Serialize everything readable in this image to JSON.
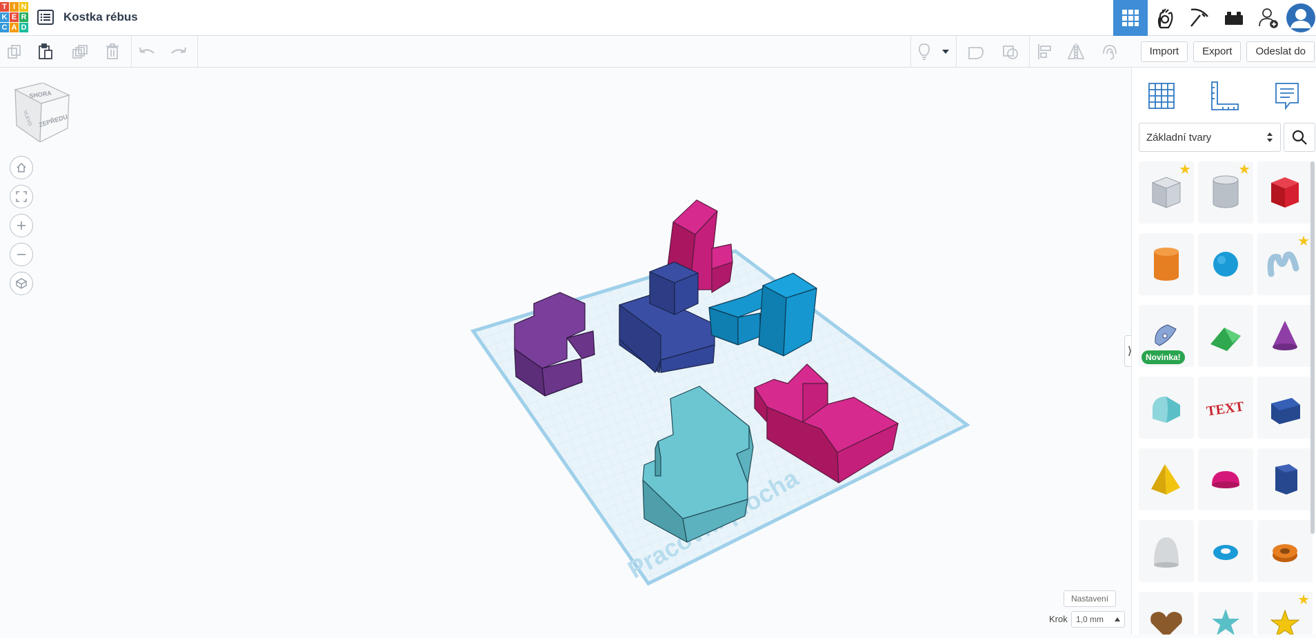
{
  "app": {
    "logo_letters": [
      "T",
      "I",
      "N",
      "K",
      "E",
      "R",
      "C",
      "A",
      "D"
    ],
    "logo_colors": [
      "#e74c3c",
      "#f39c12",
      "#f1c40f",
      "#3498db",
      "#e74c3c",
      "#27ae60",
      "#3498db",
      "#f39c12",
      "#1abc9c"
    ],
    "title": "Kostka rébus"
  },
  "top_icons": [
    "3d-design-grid-icon",
    "circuits-hand-icon",
    "minecraft-pickaxe-icon",
    "brick-icon",
    "add-user-icon",
    "user-avatar-icon"
  ],
  "toolbar": {
    "tools": [
      "copy",
      "paste",
      "duplicate",
      "delete",
      "undo",
      "redo"
    ],
    "right_tools": [
      "light-bulb",
      "dropdown",
      "group",
      "ungroup",
      "align",
      "mirror",
      "cruise"
    ]
  },
  "actions": {
    "import": "Import",
    "export": "Export",
    "send_to": "Odeslat do"
  },
  "viewcube": {
    "top": "SHORA",
    "front": "ZEPŘEDU",
    "left": "VLEVO"
  },
  "workplane": {
    "label": "Pracovní plocha"
  },
  "library": {
    "selected": "Základní tvary",
    "badge": "Novinka!",
    "shapes": [
      {
        "name": "box-hole",
        "color": "#b9c0c8",
        "star": true
      },
      {
        "name": "cylinder-hole",
        "color": "#b9c0c8",
        "star": true
      },
      {
        "name": "box",
        "color": "#d7202f",
        "star": false
      },
      {
        "name": "cylinder",
        "color": "#e67e22",
        "star": false
      },
      {
        "name": "sphere",
        "color": "#1a9bd7",
        "star": false
      },
      {
        "name": "scribble",
        "color": "#9fc4dc",
        "star": true
      },
      {
        "name": "shape-generator",
        "color": "#8aa6d6",
        "star": false,
        "badge": true
      },
      {
        "name": "roof",
        "color": "#2fa84f",
        "star": false
      },
      {
        "name": "cone",
        "color": "#8e3ea6",
        "star": false
      },
      {
        "name": "round-roof",
        "color": "#5bbfc8",
        "star": false
      },
      {
        "name": "text",
        "color": "#c9252f",
        "star": false
      },
      {
        "name": "wedge",
        "color": "#26488f",
        "star": false
      },
      {
        "name": "pyramid",
        "color": "#f1c40f",
        "star": false
      },
      {
        "name": "half-sphere",
        "color": "#d6177a",
        "star": false
      },
      {
        "name": "polygon",
        "color": "#26488f",
        "star": false
      },
      {
        "name": "paraboloid",
        "color": "#d5d8da",
        "star": false
      },
      {
        "name": "torus",
        "color": "#1a9bd7",
        "star": false
      },
      {
        "name": "tube",
        "color": "#e67e22",
        "star": false
      },
      {
        "name": "heart",
        "color": "#8b5a2b",
        "star": false
      },
      {
        "name": "star",
        "color": "#5bbfc8",
        "star": false
      },
      {
        "name": "star-favorite",
        "color": "#f1c40f",
        "star": true
      }
    ]
  },
  "footer": {
    "settings": "Nastavení",
    "step_label": "Krok",
    "step_value": "1,0 mm"
  }
}
